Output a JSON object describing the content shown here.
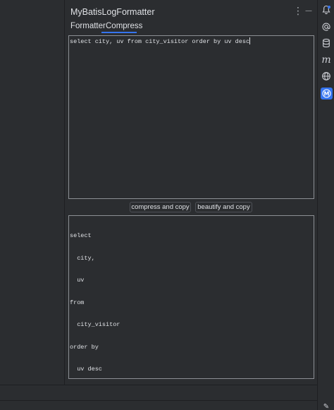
{
  "tool_window": {
    "title": "MyBatisLogFormatter",
    "options_glyph": "⋮",
    "minimize_glyph": "—"
  },
  "tabs": [
    {
      "label": "Formatter",
      "active": false
    },
    {
      "label": "Compress",
      "active": true
    }
  ],
  "input": {
    "value": "select city, uv from city_visitor order by uv desc"
  },
  "buttons": {
    "compress": "compress and copy",
    "beautify": "beautify and copy"
  },
  "output": {
    "lines": [
      "select",
      "  city,",
      "  uv",
      "from",
      "  city_visitor",
      "order by",
      "  uv desc"
    ]
  },
  "right_toolbar": {
    "icons": [
      "notifications-icon",
      "at-sign-icon",
      "database-icon",
      "maven-icon",
      "globe-icon",
      "mybatis-icon"
    ],
    "maven_glyph": "m",
    "mybatis_glyph": "M",
    "accent_color": "#3574f0"
  },
  "status": {
    "edit_glyph": "✎"
  }
}
